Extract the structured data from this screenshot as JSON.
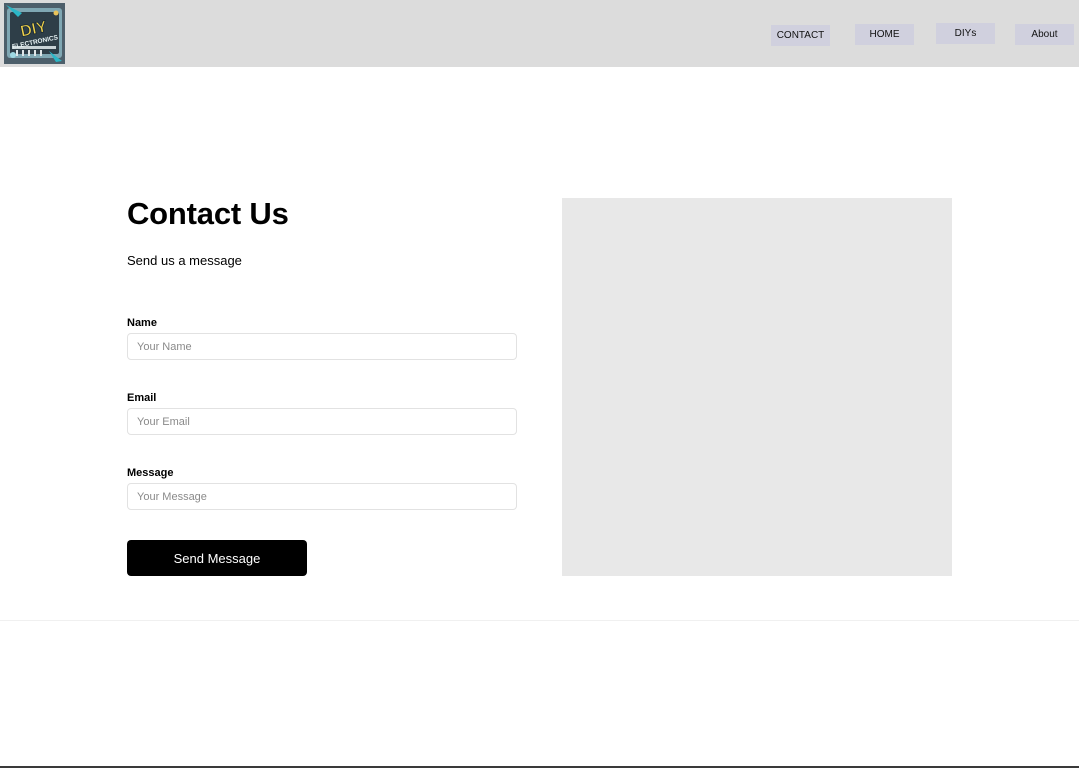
{
  "header": {
    "logo": {
      "icon": "diy-electronics-logo",
      "text_line1": "DIY",
      "text_line2": "ELECTRONICS"
    },
    "nav": [
      {
        "label": "CONTACT"
      },
      {
        "label": "HOME"
      },
      {
        "label": "DIYs"
      },
      {
        "label": "About"
      }
    ]
  },
  "main": {
    "title": "Contact Us",
    "subtitle": "Send us a message",
    "form": {
      "name": {
        "label": "Name",
        "placeholder": "Your Name",
        "value": ""
      },
      "email": {
        "label": "Email",
        "placeholder": "Your Email",
        "value": ""
      },
      "message": {
        "label": "Message",
        "placeholder": "Your Message",
        "value": ""
      },
      "submit_label": "Send Message"
    },
    "image": {
      "icon": "image-placeholder"
    }
  },
  "colors": {
    "header_bg": "#dcdcdc",
    "nav_button_bg": "#d0d0de",
    "button_bg": "#000000",
    "image_placeholder_bg": "#e8e8e8"
  }
}
